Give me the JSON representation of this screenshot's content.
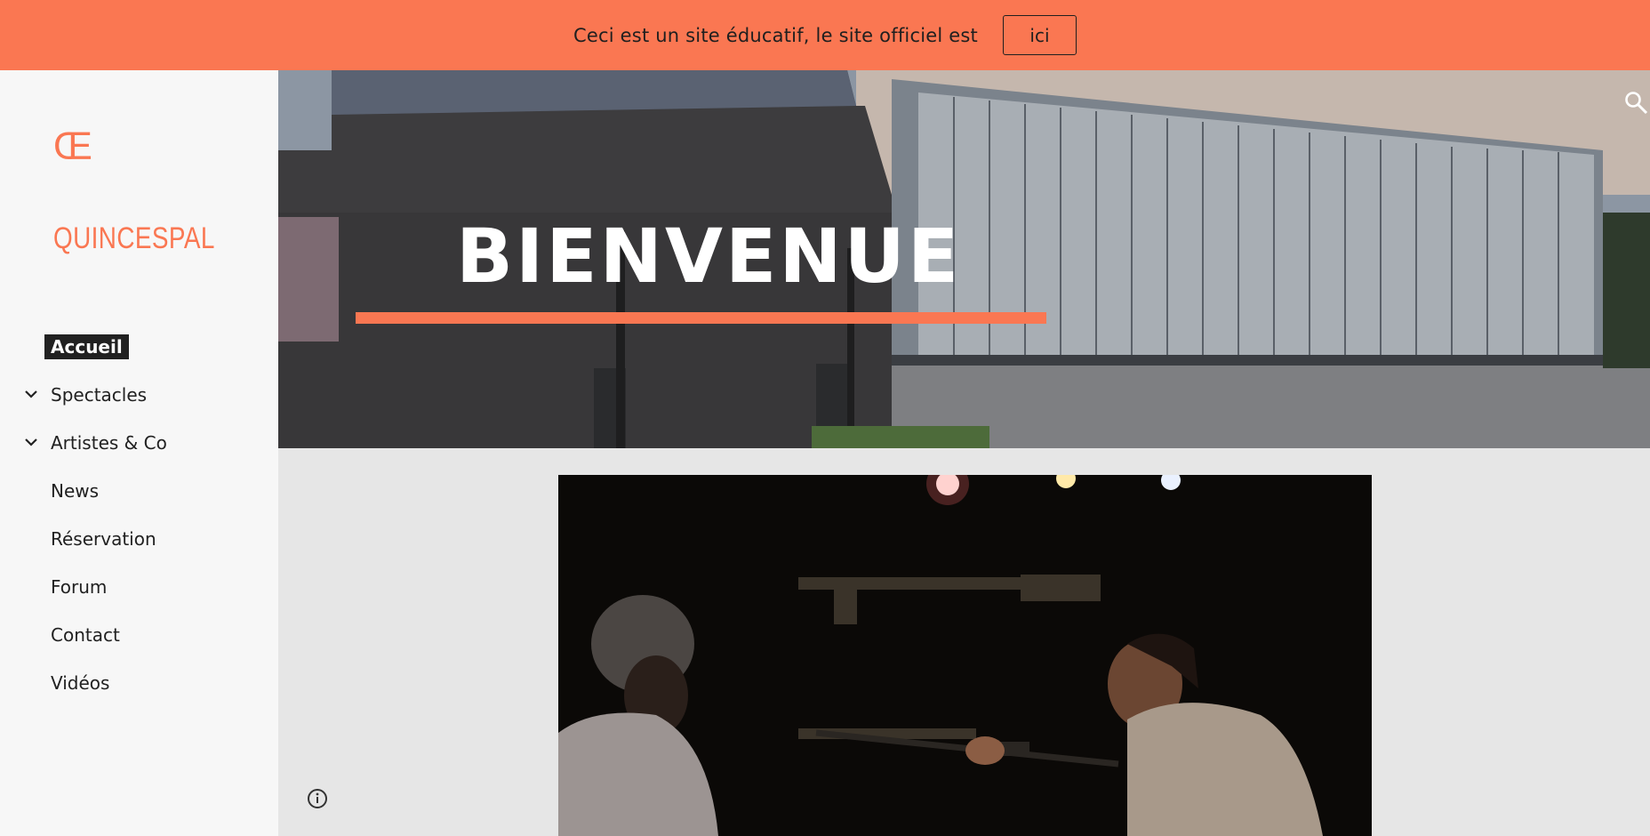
{
  "banner": {
    "text": "Ceci est un site éducatif, le site officiel est",
    "link_label": "ici",
    "background_color": "#fa7752"
  },
  "sidebar": {
    "logo_icon": "oe-ligature-logo",
    "site_name": "QUINCESPAL",
    "items": [
      {
        "label": "Accueil",
        "active": true,
        "expandable": false
      },
      {
        "label": "Spectacles",
        "active": false,
        "expandable": true
      },
      {
        "label": "Artistes & Co",
        "active": false,
        "expandable": true
      },
      {
        "label": "News",
        "active": false,
        "expandable": false
      },
      {
        "label": "Réservation",
        "active": false,
        "expandable": false
      },
      {
        "label": "Forum",
        "active": false,
        "expandable": false
      },
      {
        "label": "Contact",
        "active": false,
        "expandable": false
      },
      {
        "label": "Vidéos",
        "active": false,
        "expandable": false
      }
    ],
    "info_icon": "info-icon"
  },
  "hero": {
    "title": "BIENVENUE",
    "accent_color": "#fa7752",
    "search_icon": "search-icon"
  },
  "photo": {
    "icon": "theatre-scene-photo"
  }
}
